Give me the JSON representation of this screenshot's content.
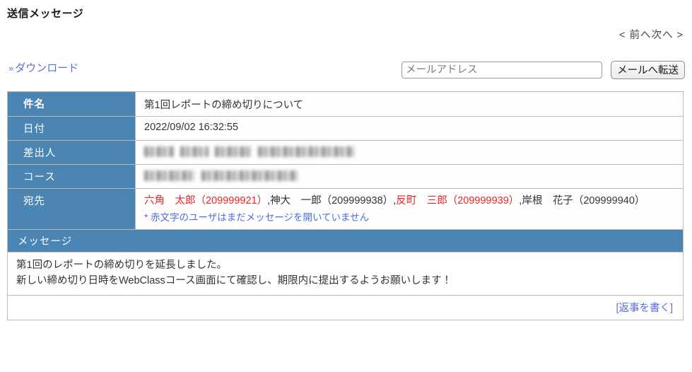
{
  "header": {
    "title": "送信メッセージ",
    "nav": {
      "prev_arrow": "<",
      "prev_label": "前へ",
      "next_label": "次へ",
      "next_arrow": ">"
    },
    "download_link": {
      "chevron": "»",
      "label": "ダウンロード"
    },
    "mail_forward": {
      "input_placeholder": "メールアドレス",
      "input_value": "",
      "button_label": "メールへ転送"
    }
  },
  "table": {
    "labels": {
      "subject": "件名",
      "date": "日付",
      "sender": "差出人",
      "course": "コース",
      "recipients": "宛先",
      "message": "メッセージ"
    },
    "subject": "第1回レポートの締め切りについて",
    "date": "2022/09/02 16:32:55",
    "sender_redacted": true,
    "course_redacted": true,
    "recipients": [
      {
        "name": "六角　太郎（209999921）",
        "unread": true
      },
      {
        "name": "神大　一郎（209999938）",
        "unread": false
      },
      {
        "name": "反町　三郎（209999939）",
        "unread": true
      },
      {
        "name": "岸根　花子（209999940）",
        "unread": false
      }
    ],
    "recipient_separator": ",",
    "recipients_note": "* 赤文字のユーザはまだメッセージを開いていません",
    "message_lines": [
      "第1回のレポートの締め切りを延長しました。",
      "新しい締め切り日時をWebClassコース画面にて確認し、期限内に提出するようお願いします！"
    ],
    "reply_link": "[返事を書く]"
  },
  "colors": {
    "header_blue": "#4a85b4",
    "link_blue": "#5b6ee0",
    "unread_red": "#e8262d",
    "note_blue": "#4a6fd8",
    "border_gray": "#b9b9b9"
  }
}
